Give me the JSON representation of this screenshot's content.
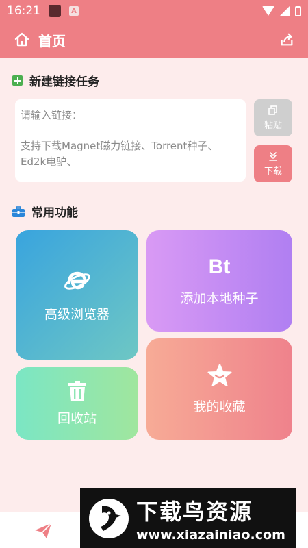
{
  "status_bar": {
    "time": "16:21",
    "badge": "A",
    "battery": "!"
  },
  "app_bar": {
    "title": "首页"
  },
  "new_task": {
    "title": "新建链接任务",
    "input_placeholder_line1": "请输入链接：",
    "input_placeholder_line2": "支持下载Magnet磁力链接、Torrent种子、Ed2k电驴、",
    "paste_label": "粘贴",
    "download_label": "下载"
  },
  "functions": {
    "title": "常用功能",
    "tiles": [
      {
        "label": "高级浏览器",
        "icon": "ie-browser-icon"
      },
      {
        "label": "添加本地种子",
        "icon_text": "Bt"
      },
      {
        "label": "回收站",
        "icon": "trash-icon"
      },
      {
        "label": "我的收藏",
        "icon": "star-icon"
      }
    ]
  },
  "watermark": {
    "title": "下载鸟资源",
    "url": "www.xiazainiao.com"
  },
  "colors": {
    "accent": "#ee7f85",
    "background": "#fdecec"
  }
}
